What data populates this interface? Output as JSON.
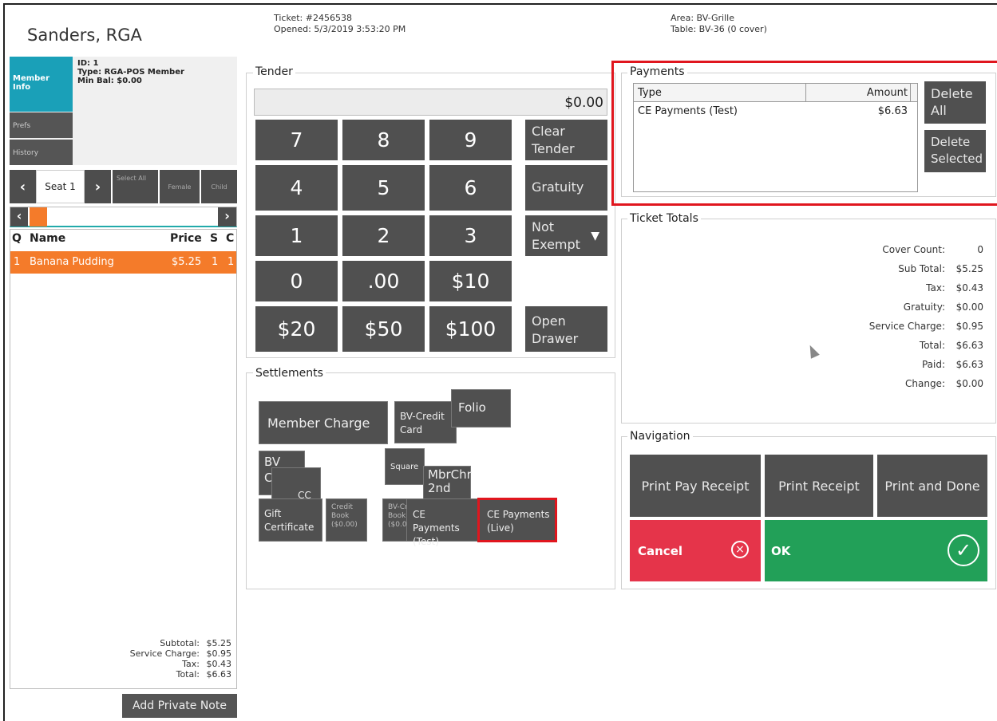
{
  "header": {
    "member_name": "Sanders, RGA",
    "ticket": "Ticket: #2456538",
    "opened": "Opened: 5/3/2019 3:53:20 PM",
    "area": "Area: BV-Grille",
    "table": "Table: BV-36 (0 cover)"
  },
  "member": {
    "tabs": {
      "info": "Member\nInfo",
      "prefs": "Prefs",
      "history": "History"
    },
    "id": "ID: 1",
    "type": "Type: RGA-POS Member",
    "min_bal": "Min Bal: $0.00"
  },
  "seat": {
    "label": "Seat 1",
    "select_all": "Select All",
    "female": "Female",
    "child": "Child"
  },
  "order": {
    "columns": [
      "Q",
      "Name",
      "Price",
      "S",
      "C"
    ],
    "items": [
      {
        "q": "1",
        "name": "Banana Pudding",
        "price": "$5.25",
        "s": "1",
        "c": "1"
      }
    ],
    "totals": [
      {
        "label": "Subtotal:",
        "value": "$5.25"
      },
      {
        "label": "Service Charge:",
        "value": "$0.95"
      },
      {
        "label": "Tax:",
        "value": "$0.43"
      },
      {
        "label": "Total:",
        "value": "$6.63"
      }
    ],
    "add_note": "Add Private Note"
  },
  "tender": {
    "title": "Tender",
    "display": "$0.00",
    "keys": [
      "7",
      "8",
      "9",
      "4",
      "5",
      "6",
      "1",
      "2",
      "3",
      "0",
      ".00",
      "$10",
      "$20",
      "$50",
      "$100"
    ],
    "clear": "Clear Tender",
    "gratuity": "Gratuity",
    "not_exempt": "Not Exempt",
    "open_drawer": "Open Drawer"
  },
  "settlements": {
    "title": "Settlements",
    "member_charge": "Member Charge",
    "bv_credit": "BV-Credit Card",
    "folio": "Folio",
    "bv_cash": "BV Cash",
    "cc": "CC",
    "square": "Square",
    "mbrchr": "MbrChr 2nd",
    "gift": "Gift Certificate",
    "credit_book": "Credit Book ($0.00)",
    "bv_cr_book": "BV-Cr Book ($0.00)",
    "ce_test": "CE Payments (Test)",
    "ce_live": "CE Payments (Live)"
  },
  "payments": {
    "title": "Payments",
    "columns": [
      "Type",
      "Amount"
    ],
    "rows": [
      {
        "type": "CE Payments (Test)",
        "amount": "$6.63"
      }
    ],
    "delete_all": "Delete All",
    "delete_selected": "Delete Selected"
  },
  "ticket_totals": {
    "title": "Ticket Totals",
    "rows": [
      {
        "label": "Cover Count:",
        "value": "0"
      },
      {
        "label": "Sub Total:",
        "value": "$5.25"
      },
      {
        "label": "Tax:",
        "value": "$0.43"
      },
      {
        "label": "Gratuity:",
        "value": "$0.00"
      },
      {
        "label": "Service Charge:",
        "value": "$0.95"
      },
      {
        "label": "Total:",
        "value": "$6.63"
      },
      {
        "label": "Paid:",
        "value": "$6.63"
      },
      {
        "label": "Change:",
        "value": "$0.00"
      }
    ]
  },
  "navigation": {
    "title": "Navigation",
    "print_pay": "Print Pay Receipt",
    "print_receipt": "Print Receipt",
    "print_done": "Print and Done",
    "cancel": "Cancel",
    "ok": "OK"
  },
  "colors": {
    "accent": "#1aa0b8",
    "order_row": "#f47b2a",
    "cancel": "#e5344a",
    "ok": "#22a058",
    "highlight": "#e0161e"
  }
}
